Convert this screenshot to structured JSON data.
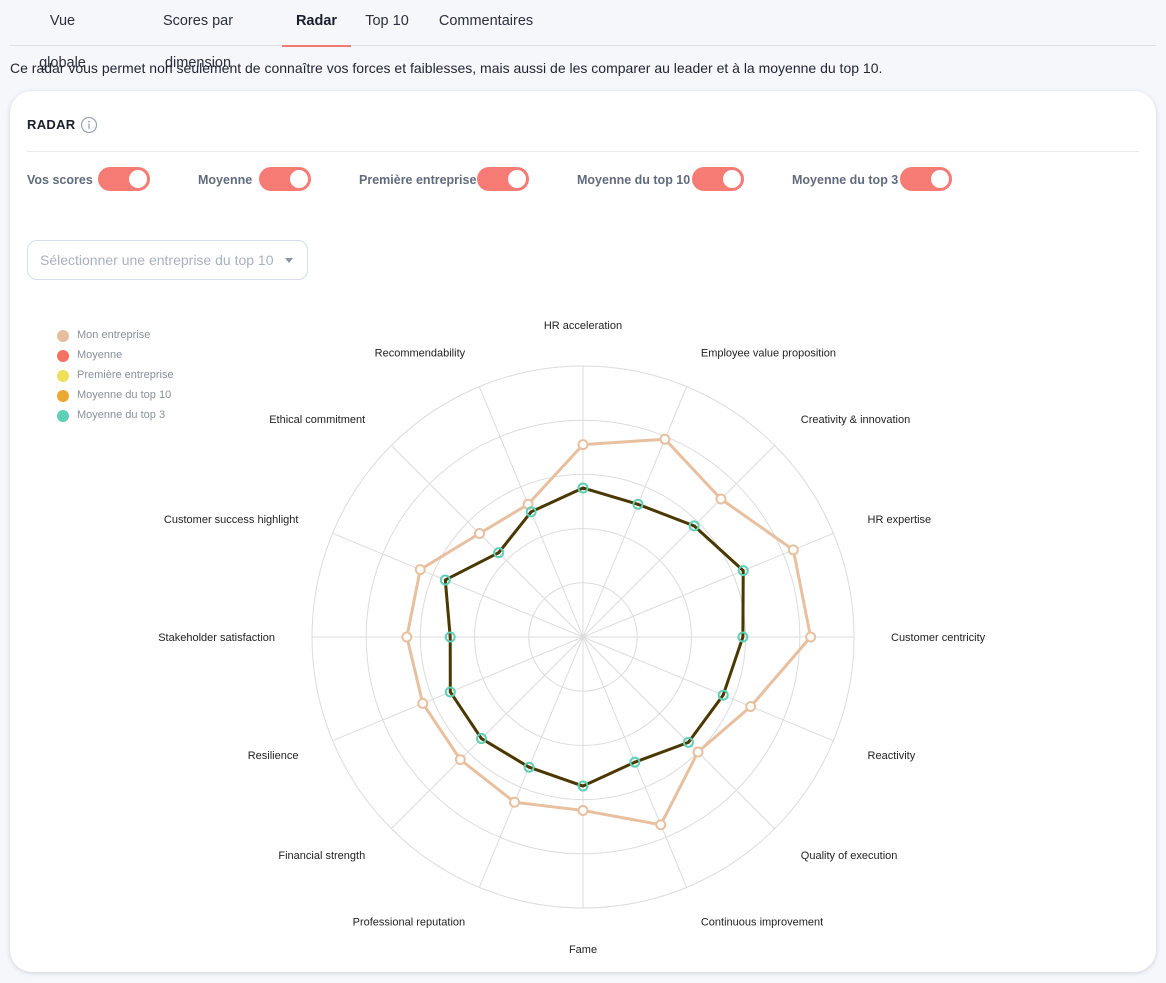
{
  "tabs": [
    {
      "label": "Vue globale"
    },
    {
      "label": "Scores par dimension"
    },
    {
      "label": "Radar"
    },
    {
      "label": "Top 10"
    },
    {
      "label": "Commentaires"
    }
  ],
  "active_tab": "Radar",
  "intro_text": "Ce radar vous permet non seulement de connaître vos forces et faiblesses, mais aussi de les comparer au leader et à la moyenne du top 10.",
  "card": {
    "title": "RADAR",
    "info_icon": "info-icon",
    "toggles": [
      {
        "label": "Vos scores",
        "on": true
      },
      {
        "label": "Moyenne",
        "on": true
      },
      {
        "label": "Première entreprise",
        "on": true
      },
      {
        "label": "Moyenne du top 10",
        "on": true
      },
      {
        "label": "Moyenne du top 3",
        "on": true
      }
    ],
    "select": {
      "placeholder": "Sélectionner une entreprise du top 10"
    }
  },
  "colors": {
    "accent": "#f67b74",
    "mon_entreprise": "#e8c0a0",
    "dark_line": "#4a3800",
    "top3_marker": "#5fcfb5"
  },
  "chart_data": {
    "type": "radar",
    "title": "",
    "grid": true,
    "rings": 5,
    "axes": [
      "HR acceleration",
      "Employee value proposition",
      "Creativity & innovation",
      "HR expertise",
      "Customer centricity",
      "Reactivity",
      "Quality of execution",
      "Continuous improvement",
      "Fame",
      "Professional reputation",
      "Financial strength",
      "Resilience",
      "Stakeholder satisfaction",
      "Customer success highlight",
      "Ethical commitment",
      "Recommendability"
    ],
    "max_value": 100,
    "legend": [
      {
        "name": "Mon entreprise",
        "color": "#e3bf9f"
      },
      {
        "name": "Moyenne",
        "color": "#f47264"
      },
      {
        "name": "Première entreprise",
        "color": "#efe05b"
      },
      {
        "name": "Moyenne du top 10",
        "color": "#eaa832"
      },
      {
        "name": "Moyenne du top 3",
        "color": "#5fcfb5"
      }
    ],
    "series": [
      {
        "name": "Mon entreprise",
        "values": [
          71,
          79,
          72,
          84,
          84,
          67,
          60,
          75,
          64,
          66,
          64,
          64,
          65,
          65,
          54,
          53
        ],
        "color": "#e8c0a0"
      },
      {
        "name": "Moyenne",
        "values": [
          55,
          53,
          58,
          64,
          59,
          56,
          55,
          50,
          55,
          52,
          53,
          53,
          49,
          55,
          44,
          50
        ],
        "color": "#4a3800"
      },
      {
        "name": "Moyenne du top 3",
        "values": [
          55,
          53,
          58,
          64,
          59,
          56,
          55,
          50,
          55,
          52,
          53,
          53,
          49,
          55,
          44,
          50
        ],
        "color": "#5fcfb5"
      }
    ]
  }
}
